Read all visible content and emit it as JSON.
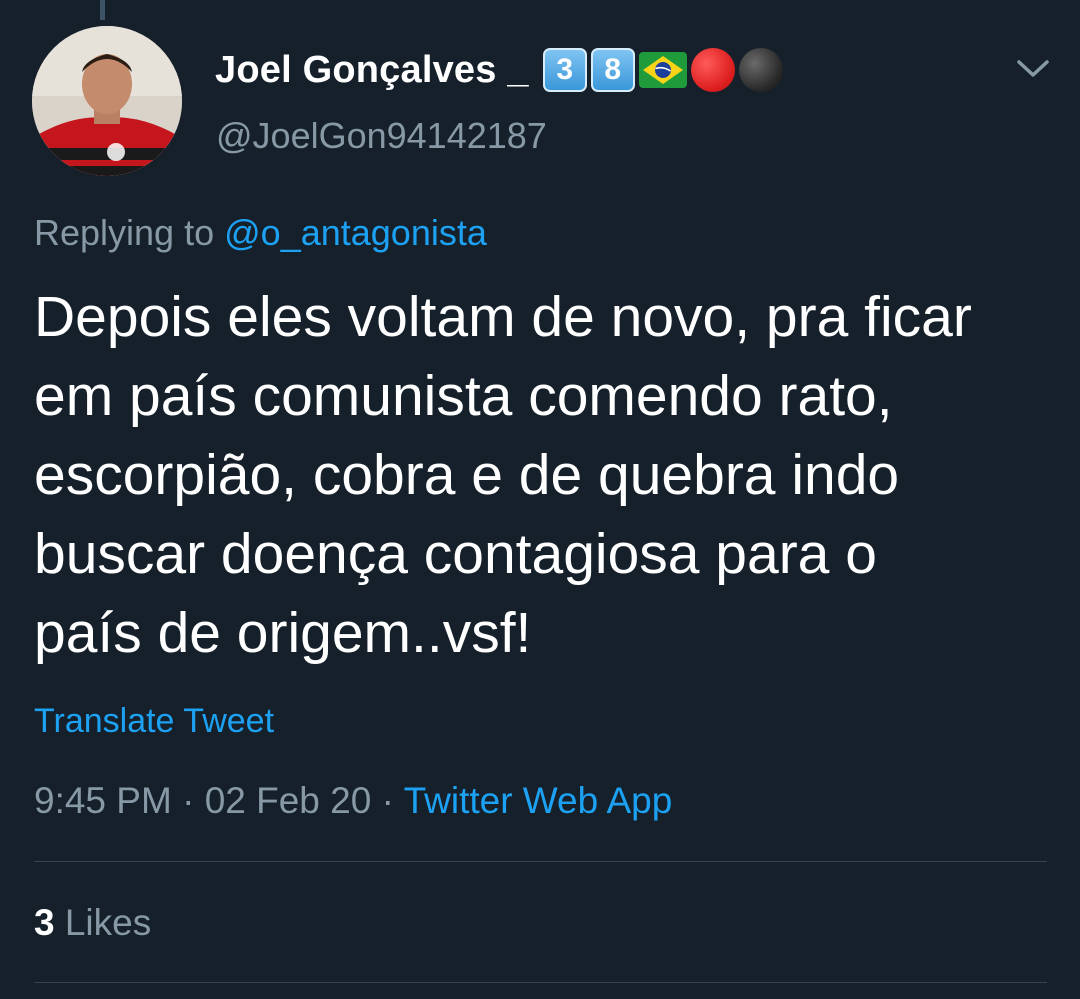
{
  "author": {
    "display_name": "Joel Gonçalves _",
    "badges": {
      "keycap_1": "3",
      "keycap_2": "8",
      "flag_icon": "brazil-flag-icon",
      "circle_1": "red-circle-icon",
      "circle_2": "black-circle-icon"
    },
    "handle": "@JoelGon94142187",
    "avatar_icon": "profile-photo"
  },
  "reply": {
    "prefix": "Replying to",
    "mention": "@o_antagonista"
  },
  "tweet": {
    "text": "Depois eles voltam de novo, pra ficar\nem país comunista comendo rato,\nescorpião, cobra e de quebra indo\nbuscar doença contagiosa para o\npaís de origem..vsf!",
    "translate_label": "Translate Tweet",
    "time": "9:45 PM",
    "date": "02 Feb 20",
    "separator": "·",
    "source": "Twitter Web App"
  },
  "stats": {
    "likes_count": "3",
    "likes_label": "Likes"
  },
  "colors": {
    "background": "#15202b",
    "accent": "#1da1f2",
    "secondary_text": "#8899a6",
    "primary_text": "#ffffff",
    "divider": "#38444d"
  },
  "icons": {
    "menu": "chevron-down-icon"
  }
}
